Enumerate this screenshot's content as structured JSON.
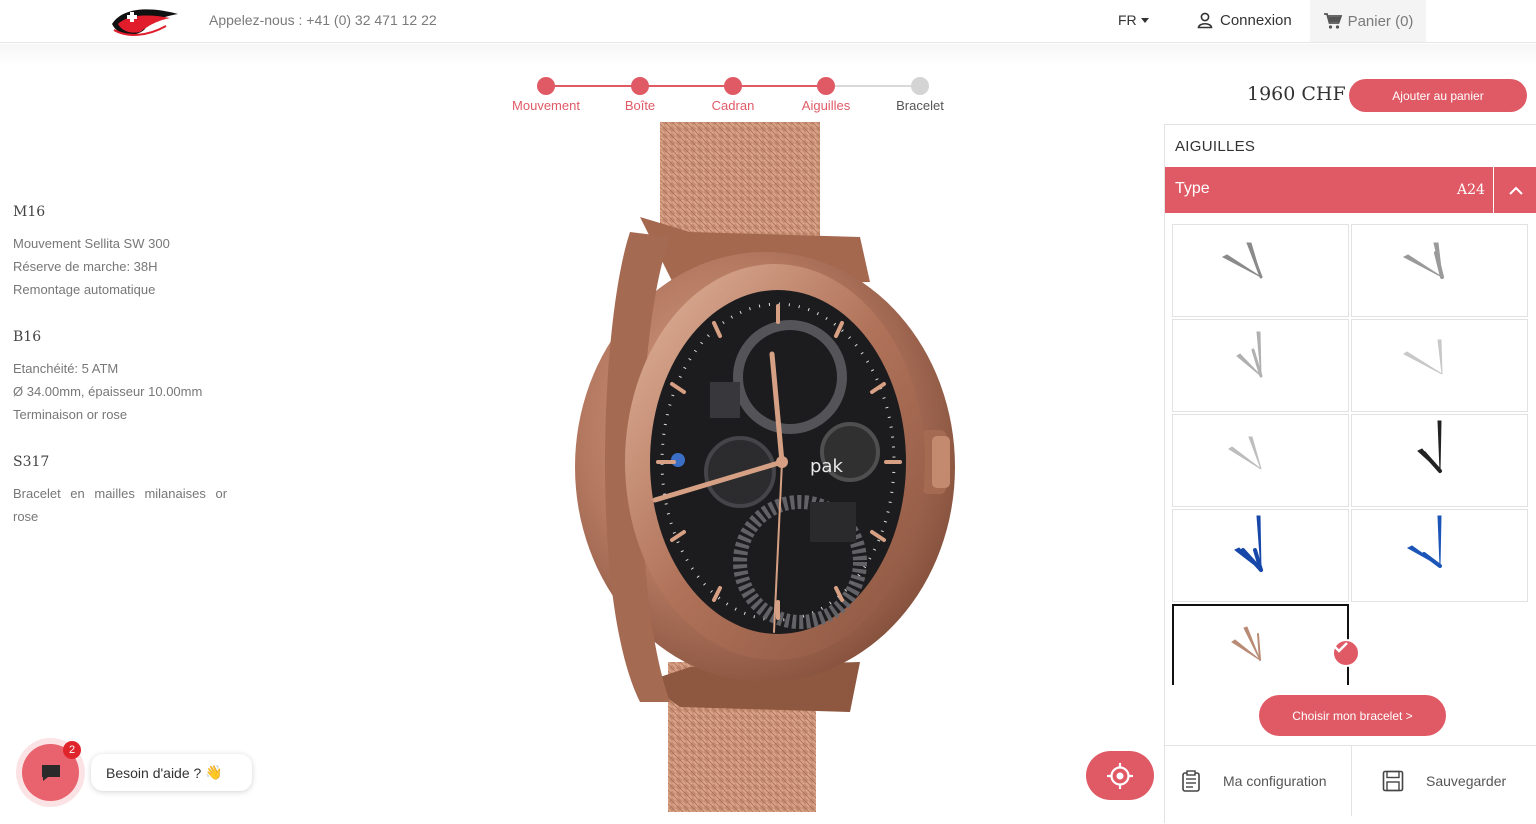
{
  "header": {
    "phone_text": "Appelez-nous : +41 (0) 32 471 12 22",
    "lang": "FR",
    "login_label": "Connexion",
    "cart_label": "Panier (0)"
  },
  "stepper": {
    "steps": [
      {
        "label": "Mouvement",
        "done": true
      },
      {
        "label": "Boîte",
        "done": true
      },
      {
        "label": "Cadran",
        "done": true
      },
      {
        "label": "Aiguilles",
        "done": true
      },
      {
        "label": "Bracelet",
        "done": false
      }
    ],
    "active_color": "#e05a66",
    "inactive_color": "#d4d4d4"
  },
  "specs": [
    {
      "code": "M16",
      "lines": [
        "Mouvement Sellita SW 300",
        "Réserve de marche: 38H",
        "Remontage automatique"
      ]
    },
    {
      "code": "B16",
      "lines": [
        "Etanchéité: 5 ATM",
        "Ø 34.00mm, épaisseur 10.00mm",
        "Terminaison or rose"
      ]
    },
    {
      "code": "S317",
      "lines": [
        "Bracelet en mailles milanaises or",
        "rose"
      ]
    }
  ],
  "watch": {
    "brand": "pak",
    "case_color": "#b4775e",
    "dial_color": "#1c1c1e"
  },
  "order": {
    "price": "1960 CHF",
    "add_to_cart_label": "Ajouter au panier"
  },
  "panel": {
    "title": "AIGUILLES",
    "type_label": "Type",
    "type_value": "A24",
    "options": [
      {
        "icon": "hands-grey-dark-icon",
        "color": "#8a8a8a",
        "selected": false
      },
      {
        "icon": "hands-grey-icon",
        "color": "#9a9a9a",
        "selected": false
      },
      {
        "icon": "hands-silver-icon",
        "color": "#b0b0b0",
        "selected": false
      },
      {
        "icon": "hands-light-silver-icon",
        "color": "#c8c8c8",
        "selected": false
      },
      {
        "icon": "hands-pale-silver-icon",
        "color": "#bdbdbd",
        "selected": false
      },
      {
        "icon": "hands-black-icon",
        "color": "#222222",
        "selected": false
      },
      {
        "icon": "hands-blue-icon",
        "color": "#1747a8",
        "selected": false
      },
      {
        "icon": "hands-blue-alt-icon",
        "color": "#1c55b8",
        "selected": false
      },
      {
        "icon": "hands-rose-gold-icon",
        "color": "#b98a74",
        "selected": true
      }
    ],
    "next_label": "Choisir mon bracelet >",
    "my_config_label": "Ma configuration",
    "save_label": "Sauvegarder"
  },
  "chat": {
    "badge_count": "2",
    "help_text": "Besoin d'aide ?",
    "help_emoji": "👋"
  },
  "accent_color": "#e05a66"
}
